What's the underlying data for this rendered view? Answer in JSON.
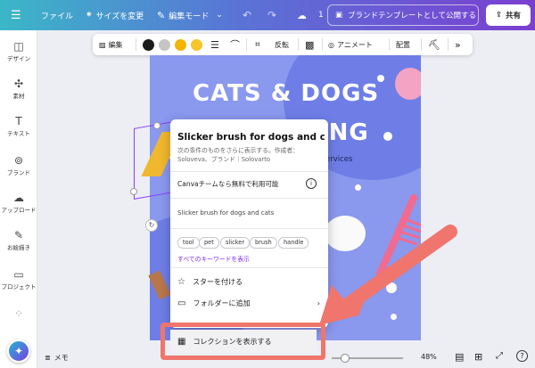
{
  "topbar": {
    "menu_icon": "hamburger-icon",
    "file": "ファイル",
    "resize": "サイズを変更",
    "edit_mode": "編集モード",
    "publish": "ブランドテンプレートとして公開する",
    "share": "共有"
  },
  "sidebar": {
    "items": [
      {
        "label": "デザイン",
        "icon": "layout-icon"
      },
      {
        "label": "素材",
        "icon": "elements-icon"
      },
      {
        "label": "テキスト",
        "icon": "text-icon"
      },
      {
        "label": "ブランド",
        "icon": "brand-icon"
      },
      {
        "label": "アップロード",
        "icon": "upload-icon"
      },
      {
        "label": "お絵描き",
        "icon": "draw-icon"
      },
      {
        "label": "プロジェクト",
        "icon": "folder-icon"
      }
    ]
  },
  "toolbar": {
    "edit": "編集",
    "colors": [
      "#1b1b1b",
      "#c4c4c4",
      "#f4b400",
      "#f7c42a"
    ],
    "flip": "反転",
    "animate": "アニメート",
    "position": "配置"
  },
  "design": {
    "title_line1": "CATS & DOGS",
    "title_line2": "ING",
    "services": "ervices",
    "colors": {
      "background": "#8a98ee",
      "accent": "#f26a8d"
    }
  },
  "popup": {
    "title": "Slicker brush for dogs and ca...",
    "subtitle": "次の条件のものをさらに表示する。作成者：Soloveva、ブランド｜Solovarto",
    "free_text": "Canvaチームなら無料で利用可能",
    "description": "Slicker brush for dogs and cats",
    "tags": [
      "tool",
      "pet",
      "slicker",
      "brush",
      "handle"
    ],
    "all_keywords": "すべてのキーワードを表示",
    "star": "スターを付ける",
    "add_folder": "フォルダーに追加",
    "show_collection": "コレクションを表示する"
  },
  "bottom": {
    "memo": "メモ",
    "zoom": "48%"
  }
}
